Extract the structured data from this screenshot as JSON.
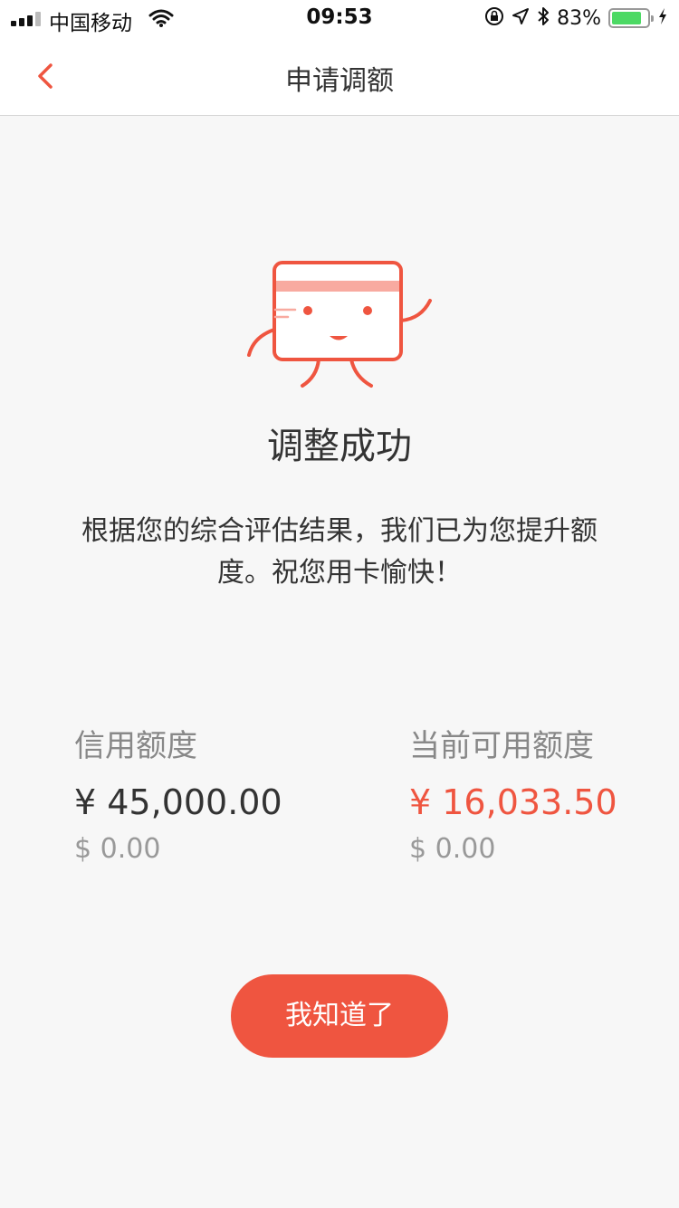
{
  "status_bar": {
    "carrier": "中国移动",
    "time": "09:53",
    "battery_percent": "83%",
    "battery_level": 0.83,
    "icons": [
      "signal-icon",
      "wifi-icon",
      "rotation-lock-icon",
      "location-icon",
      "bluetooth-icon",
      "battery-icon",
      "charging-icon"
    ]
  },
  "nav": {
    "title": "申请调额",
    "back_icon": "chevron-left-icon"
  },
  "result": {
    "illustration": "card-mascot-icon",
    "title": "调整成功",
    "description": "根据您的综合评估结果，我们已为您提升额度。祝您用卡愉快！"
  },
  "limits": {
    "credit": {
      "label": "信用额度",
      "cny": "¥ 45,000.00",
      "usd": "$ 0.00"
    },
    "available": {
      "label": "当前可用额度",
      "cny": "¥ 16,033.50",
      "usd": "$ 0.00"
    }
  },
  "actions": {
    "confirm_label": "我知道了"
  },
  "colors": {
    "accent": "#ef5540",
    "background": "#f7f7f7",
    "text_primary": "#333333",
    "text_secondary": "#888888"
  }
}
